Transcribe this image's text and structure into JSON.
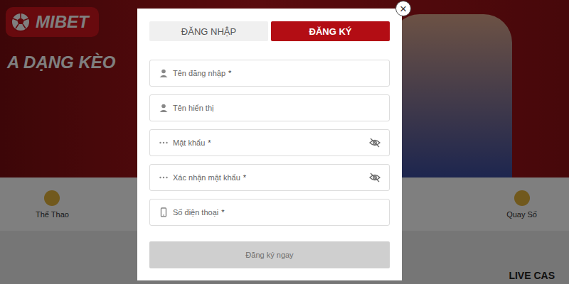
{
  "logo": {
    "text": "MIBET"
  },
  "banner": {
    "headline": "A DẠNG KÈO"
  },
  "nav": [
    {
      "label": "Thể Thao"
    },
    {
      "label": "Quay Số"
    }
  ],
  "live_label": "LIVE CAS",
  "modal": {
    "close": "×",
    "tabs": [
      {
        "label": "ĐĂNG NHẬP",
        "selected": false
      },
      {
        "label": "ĐĂNG KÝ",
        "selected": true
      }
    ],
    "required_mark": "*",
    "fields": [
      {
        "placeholder": "Tên đăng nhập",
        "required": true,
        "kind": "user"
      },
      {
        "placeholder": "Tên hiển thị",
        "required": false,
        "kind": "user"
      },
      {
        "placeholder": "Mật khẩu",
        "required": true,
        "kind": "password"
      },
      {
        "placeholder": "Xác nhận mật khẩu",
        "required": true,
        "kind": "password"
      },
      {
        "placeholder": "Số điện thoại",
        "required": true,
        "kind": "phone"
      }
    ],
    "submit": {
      "label": "Đăng ký ngay",
      "disabled": true
    }
  }
}
